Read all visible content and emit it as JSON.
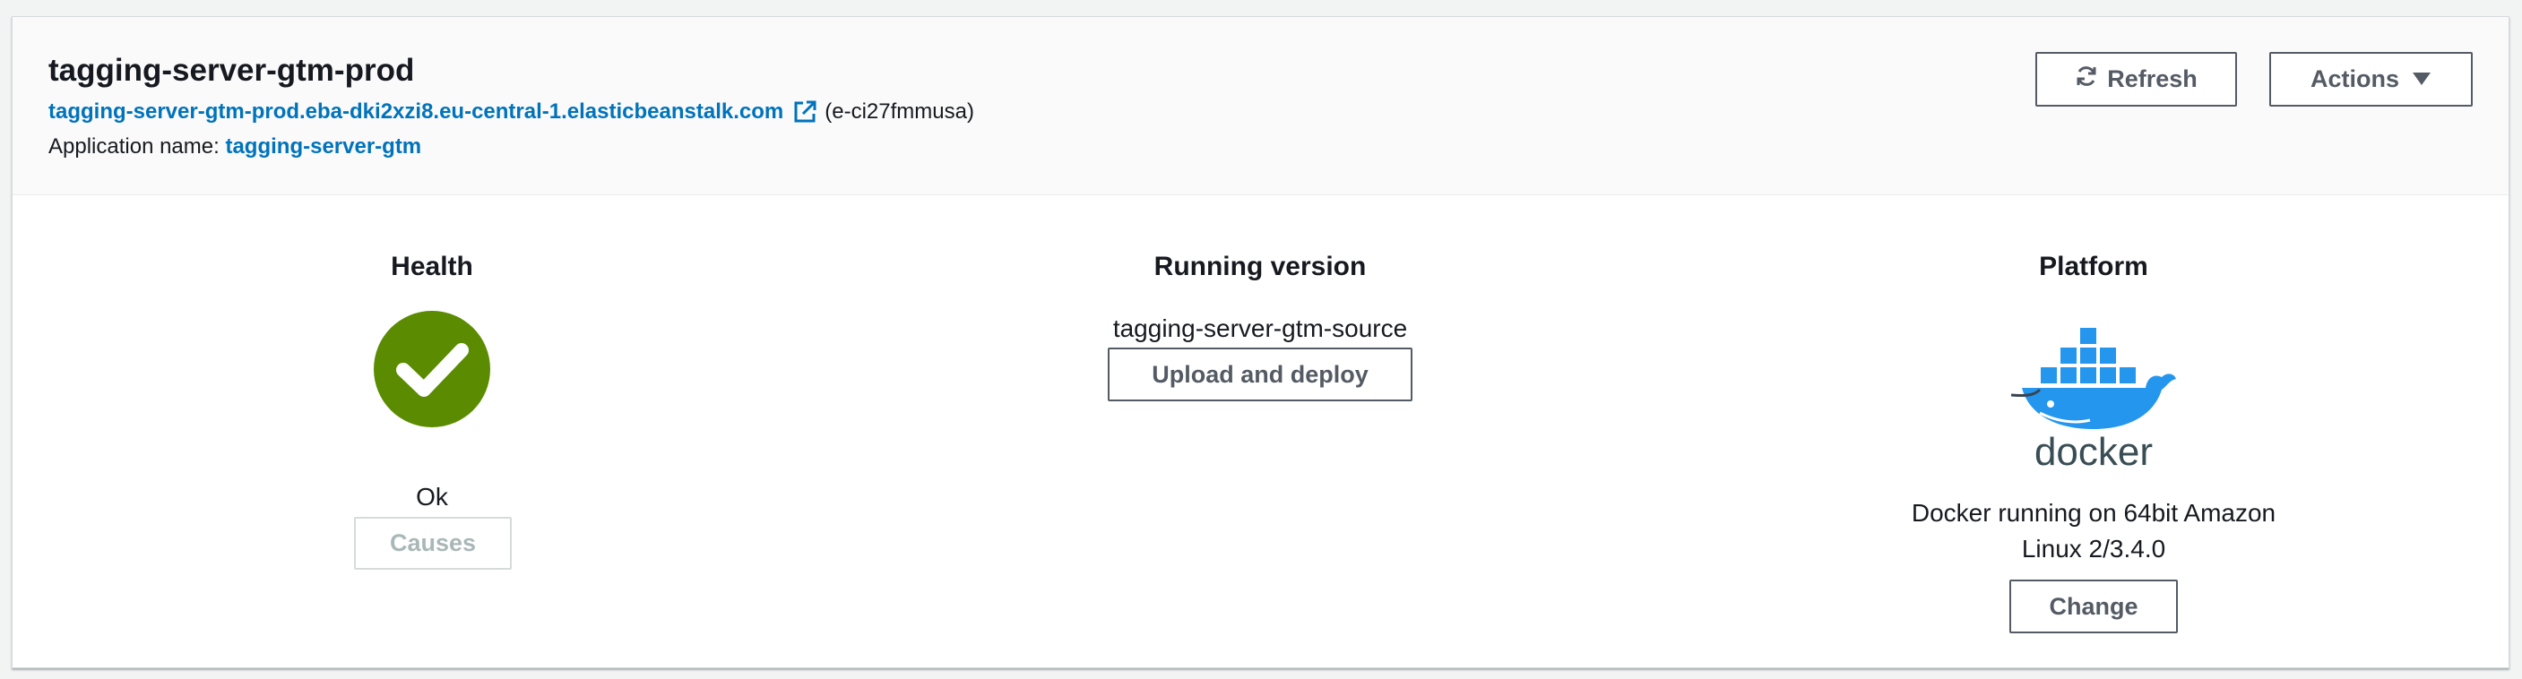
{
  "environment": {
    "name": "tagging-server-gtm-prod",
    "url": "tagging-server-gtm-prod.eba-dki2xzi8.eu-central-1.elasticbeanstalk.com",
    "id": "(e-ci27fmmusa)",
    "application_label": "Application name:",
    "application_name": "tagging-server-gtm"
  },
  "toolbar": {
    "refresh_label": "Refresh",
    "actions_label": "Actions",
    "refresh_icon": "refresh-icon",
    "actions_icon": "caret-down-icon"
  },
  "health": {
    "title": "Health",
    "status": "Ok",
    "icon": "check-circle-icon",
    "status_color": "#5a8b00",
    "causes_label": "Causes"
  },
  "version": {
    "title": "Running version",
    "name": "tagging-server-gtm-source",
    "upload_label": "Upload and deploy"
  },
  "platform": {
    "title": "Platform",
    "logo": "docker-logo",
    "logo_text": "docker",
    "description": "Docker running on 64bit Amazon Linux 2/3.4.0",
    "change_label": "Change"
  },
  "colors": {
    "link": "#0073bb",
    "docker_blue": "#2496ed"
  }
}
